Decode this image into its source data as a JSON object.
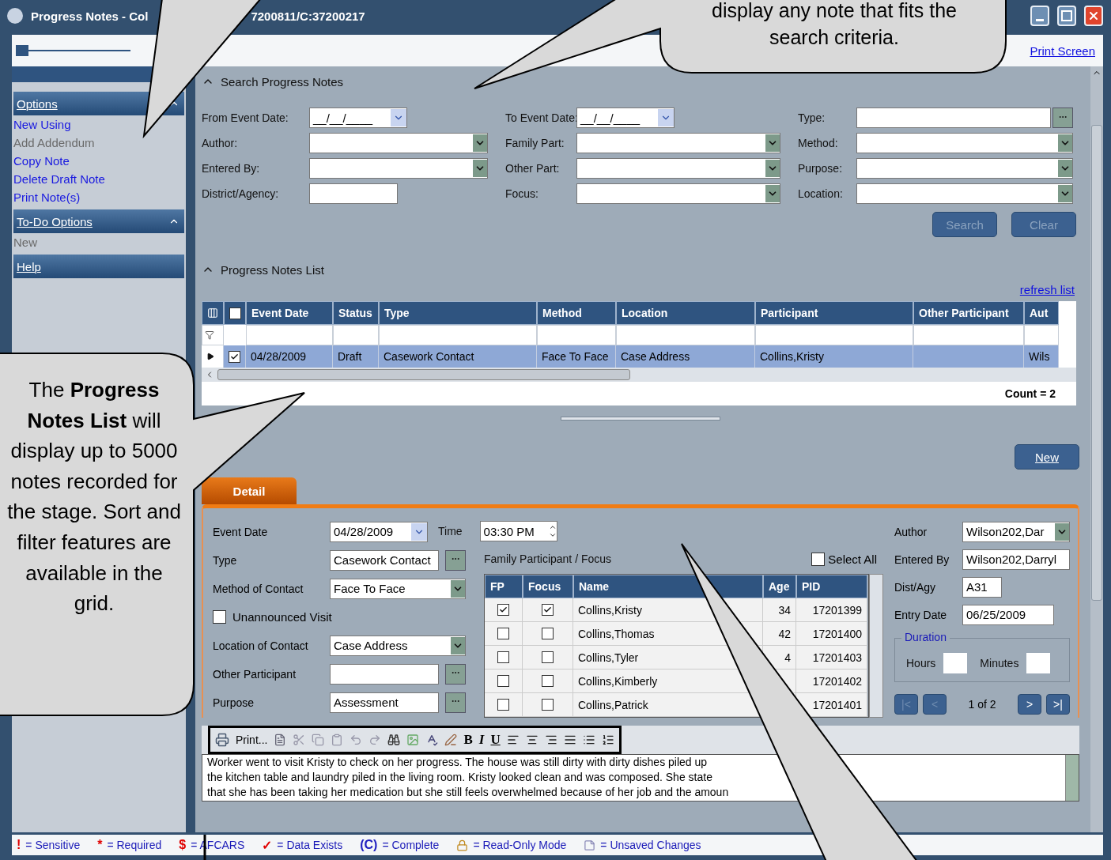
{
  "window": {
    "title_left": "Progress Notes - Col",
    "title_right": "7200811/C:37200217"
  },
  "top_bar": {
    "print_link": "Print Screen"
  },
  "sidebar": {
    "sections": [
      {
        "title": "Options",
        "expanded": true,
        "items": [
          {
            "label": "New Using",
            "disabled": false
          },
          {
            "label": "Add Addendum",
            "disabled": true
          },
          {
            "label": "Copy Note",
            "disabled": false
          },
          {
            "label": "Delete Draft Note",
            "disabled": false
          },
          {
            "label": "Print Note(s)",
            "disabled": false
          }
        ]
      },
      {
        "title": "To-Do Options",
        "expanded": true,
        "items": [
          {
            "label": "New",
            "disabled": true
          }
        ]
      },
      {
        "title": "Help",
        "expanded": false
      }
    ]
  },
  "search": {
    "title": "Search Progress Notes",
    "expanded": true,
    "fields": [
      {
        "label": "From Event Date:",
        "kind": "date",
        "value": "__/__/____"
      },
      {
        "label": "To Event Date:",
        "kind": "date",
        "value": "__/__/____"
      },
      {
        "label": "Type:",
        "kind": "lookup"
      },
      {
        "label": "Author:",
        "kind": "combo"
      },
      {
        "label": "Family Part:",
        "kind": "combo"
      },
      {
        "label": "Method:",
        "kind": "combo"
      },
      {
        "label": "Entered By:",
        "kind": "combo"
      },
      {
        "label": "Other Part:",
        "kind": "combo"
      },
      {
        "label": "Purpose:",
        "kind": "combo"
      },
      {
        "label": "District/Agency:",
        "kind": "text"
      },
      {
        "label": "Focus:",
        "kind": "combo"
      },
      {
        "label": "Location:",
        "kind": "combo"
      }
    ],
    "buttons": [
      {
        "label": "Search",
        "disabled": true
      },
      {
        "label": "Clear",
        "disabled": true
      }
    ]
  },
  "notes_list": {
    "title": "Progress Notes List",
    "expanded": true,
    "refresh_link": "refresh list",
    "columns": [
      "Event Date",
      "Status",
      "Type",
      "Method",
      "Location",
      "Participant",
      "Other Participant",
      "Aut"
    ],
    "select_all_checked": false,
    "rows": [
      {
        "checked": true,
        "selected": true,
        "cells": [
          "04/28/2009",
          "Draft",
          "Casework Contact",
          "Face To Face",
          "Case Address",
          "Collins,Kristy",
          null,
          "Wils"
        ]
      }
    ],
    "count": "Count = 2",
    "new_button": "New"
  },
  "detail": {
    "tab": "Detail",
    "fields": [
      {
        "kind": "date",
        "label": "Event Date",
        "value": "04/28/2009"
      },
      {
        "kind": "lookup",
        "label": "Type",
        "value": "Casework Contact"
      },
      {
        "kind": "combo",
        "label": "Method of Contact",
        "value": "Face To Face"
      },
      {
        "kind": "checkbox",
        "label": "Unannounced Visit",
        "checked": false
      },
      {
        "kind": "combo",
        "label": "Location of Contact",
        "value": "Case Address"
      },
      {
        "kind": "lookup",
        "label": "Other Participant"
      },
      {
        "kind": "lookup",
        "label": "Purpose",
        "value": "Assessment"
      }
    ],
    "time": {
      "label": "Time",
      "value": "03:30 PM"
    },
    "participants": {
      "title": "Family Participant / Focus",
      "select_all": {
        "label": "Select All",
        "checked": false
      },
      "columns": [
        "FP",
        "Focus",
        "Name",
        "Age",
        "PID"
      ],
      "rows": [
        {
          "fp": true,
          "focus": true,
          "name": "Collins,Kristy",
          "age": "34",
          "pid": "17201399"
        },
        {
          "fp": false,
          "focus": false,
          "name": "Collins,Thomas",
          "age": "42",
          "pid": "17201400"
        },
        {
          "fp": false,
          "focus": false,
          "name": "Collins,Tyler",
          "age": "4",
          "pid": "17201403"
        },
        {
          "fp": false,
          "focus": false,
          "name": "Collins,Kimberly",
          "pid": "17201402"
        },
        {
          "fp": false,
          "focus": false,
          "name": "Collins,Patrick",
          "pid": "17201401"
        }
      ]
    },
    "right_fields": [
      {
        "kind": "combo",
        "label": "Author",
        "value": "Wilson202,Dar"
      },
      {
        "kind": "text",
        "label": "Entered By",
        "value": "Wilson202,Darryl"
      },
      {
        "kind": "short",
        "label": "Dist/Agy",
        "value": "A31"
      },
      {
        "kind": "text",
        "label": "Entry Date",
        "value": "06/25/2009"
      }
    ],
    "duration": {
      "title": "Duration",
      "hours": "Hours",
      "minutes": "Minutes"
    },
    "pager": {
      "text": "1 of 2",
      "buttons": [
        {
          "label": "|<",
          "disabled": true
        },
        {
          "label": "<",
          "disabled": true
        },
        {
          "label": ">",
          "disabled": false
        },
        {
          "label": ">|",
          "disabled": false
        }
      ]
    },
    "editor": {
      "print": "Print...",
      "format_buttons": [
        "B",
        "I",
        "U"
      ],
      "lines": [
        "Worker went to visit Kristy to check on her progress.  The house was still dirty with dirty dishes piled up",
        "the kitchen table and laundry piled in the living room.  Kristy looked clean and was composed.  She state",
        "that she has been taking her medication but she still feels overwhelmed because of her job and the amoun"
      ]
    }
  },
  "legend": [
    {
      "kind": "symbol",
      "symbol": "!",
      "color": "#e00000",
      "label": "= Sensitive"
    },
    {
      "kind": "symbol",
      "symbol": "*",
      "color": "#e00000",
      "label": "= Required"
    },
    {
      "kind": "symbol",
      "symbol": "$",
      "color": "#e00000",
      "label": "= AFCARS"
    },
    {
      "kind": "symbol",
      "symbol": "✓",
      "color": "#e00000",
      "label": "= Data Exists"
    },
    {
      "kind": "symbol",
      "symbol": "(C)",
      "color": "#2020c0",
      "label": "= Complete"
    },
    {
      "kind": "lock",
      "label": "= Read-Only Mode"
    },
    {
      "kind": "note",
      "label": "= Unsaved Changes"
    }
  ],
  "callouts": [
    {
      "text": "display any note that fits the search criteria."
    },
    {
      "text": "The **Progress Notes List** will display up to 5000 notes recorded for the stage. Sort and filter features are available in the grid."
    }
  ]
}
